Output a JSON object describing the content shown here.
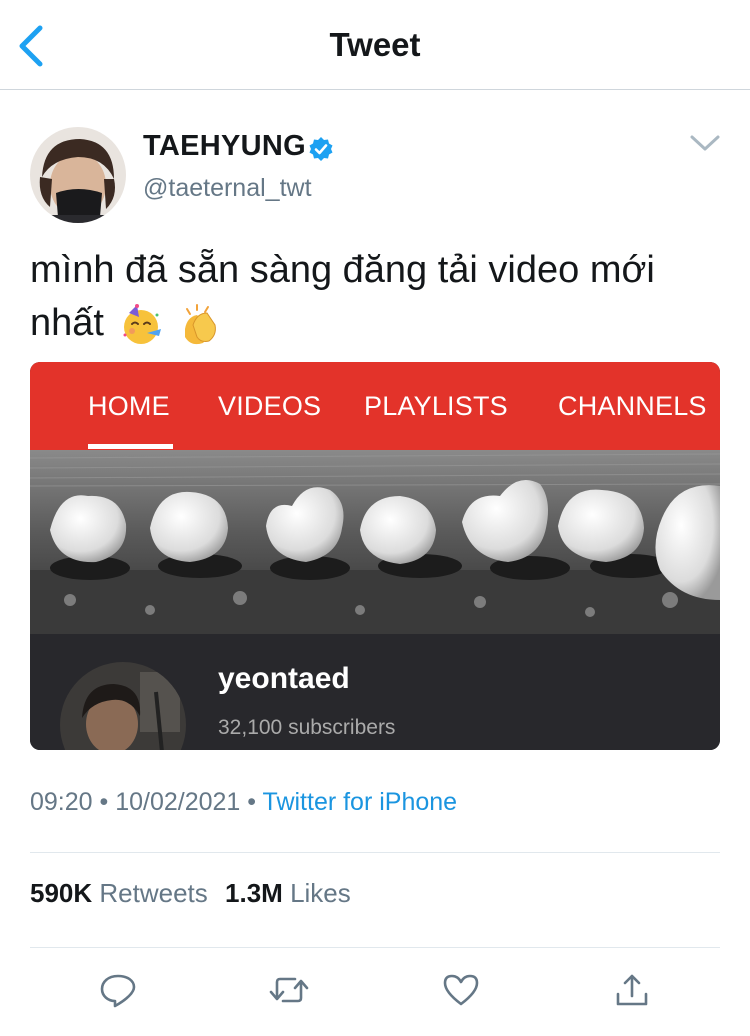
{
  "nav": {
    "title": "Tweet"
  },
  "author": {
    "name": "TAEHYUNG",
    "handle": "@taeternal_twt",
    "verified": true
  },
  "tweet": {
    "text": "mình đã sẵn sàng đăng tải video mới nhất",
    "emojis": [
      "partying-face-emoji",
      "clapping-hands-emoji"
    ]
  },
  "media": {
    "tabs": [
      "HOME",
      "VIDEOS",
      "PLAYLISTS",
      "CHANNELS"
    ],
    "active_tab": "HOME",
    "channel_name": "yeontaed",
    "subscribers": "32,100 subscribers"
  },
  "meta": {
    "time": "09:20",
    "date": "10/02/2021",
    "source": "Twitter for iPhone"
  },
  "stats": {
    "retweets_count": "590K",
    "retweets_label": "Retweets",
    "likes_count": "1.3M",
    "likes_label": "Likes"
  },
  "actions": [
    "reply-icon",
    "retweet-icon",
    "like-icon",
    "share-icon"
  ],
  "colors": {
    "link": "#1b95e0",
    "verified": "#1da1f2",
    "youtube_red": "#e3332a",
    "secondary_text": "#657786"
  }
}
